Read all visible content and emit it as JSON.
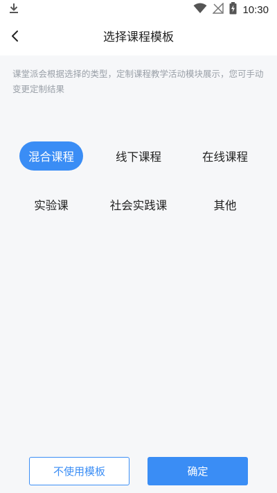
{
  "status_bar": {
    "time": "10:30",
    "icons": [
      "download-icon",
      "wifi-icon",
      "no-signal-icon",
      "battery-charging-icon"
    ]
  },
  "nav": {
    "title": "选择课程模板",
    "back_icon": "chevron-left-icon"
  },
  "description": "课堂派会根据选择的类型，定制课程教学活动模块展示，您可手动变更定制结果",
  "templates": [
    {
      "label": "混合课程",
      "selected": true
    },
    {
      "label": "线下课程",
      "selected": false
    },
    {
      "label": "在线课程",
      "selected": false
    },
    {
      "label": "实验课",
      "selected": false
    },
    {
      "label": "社会实践课",
      "selected": false
    },
    {
      "label": "其他",
      "selected": false
    }
  ],
  "footer": {
    "no_template_label": "不使用模板",
    "confirm_label": "确定"
  },
  "colors": {
    "accent": "#3a8df5",
    "background": "#f6f7f9",
    "description_text": "#9aa0a8"
  }
}
